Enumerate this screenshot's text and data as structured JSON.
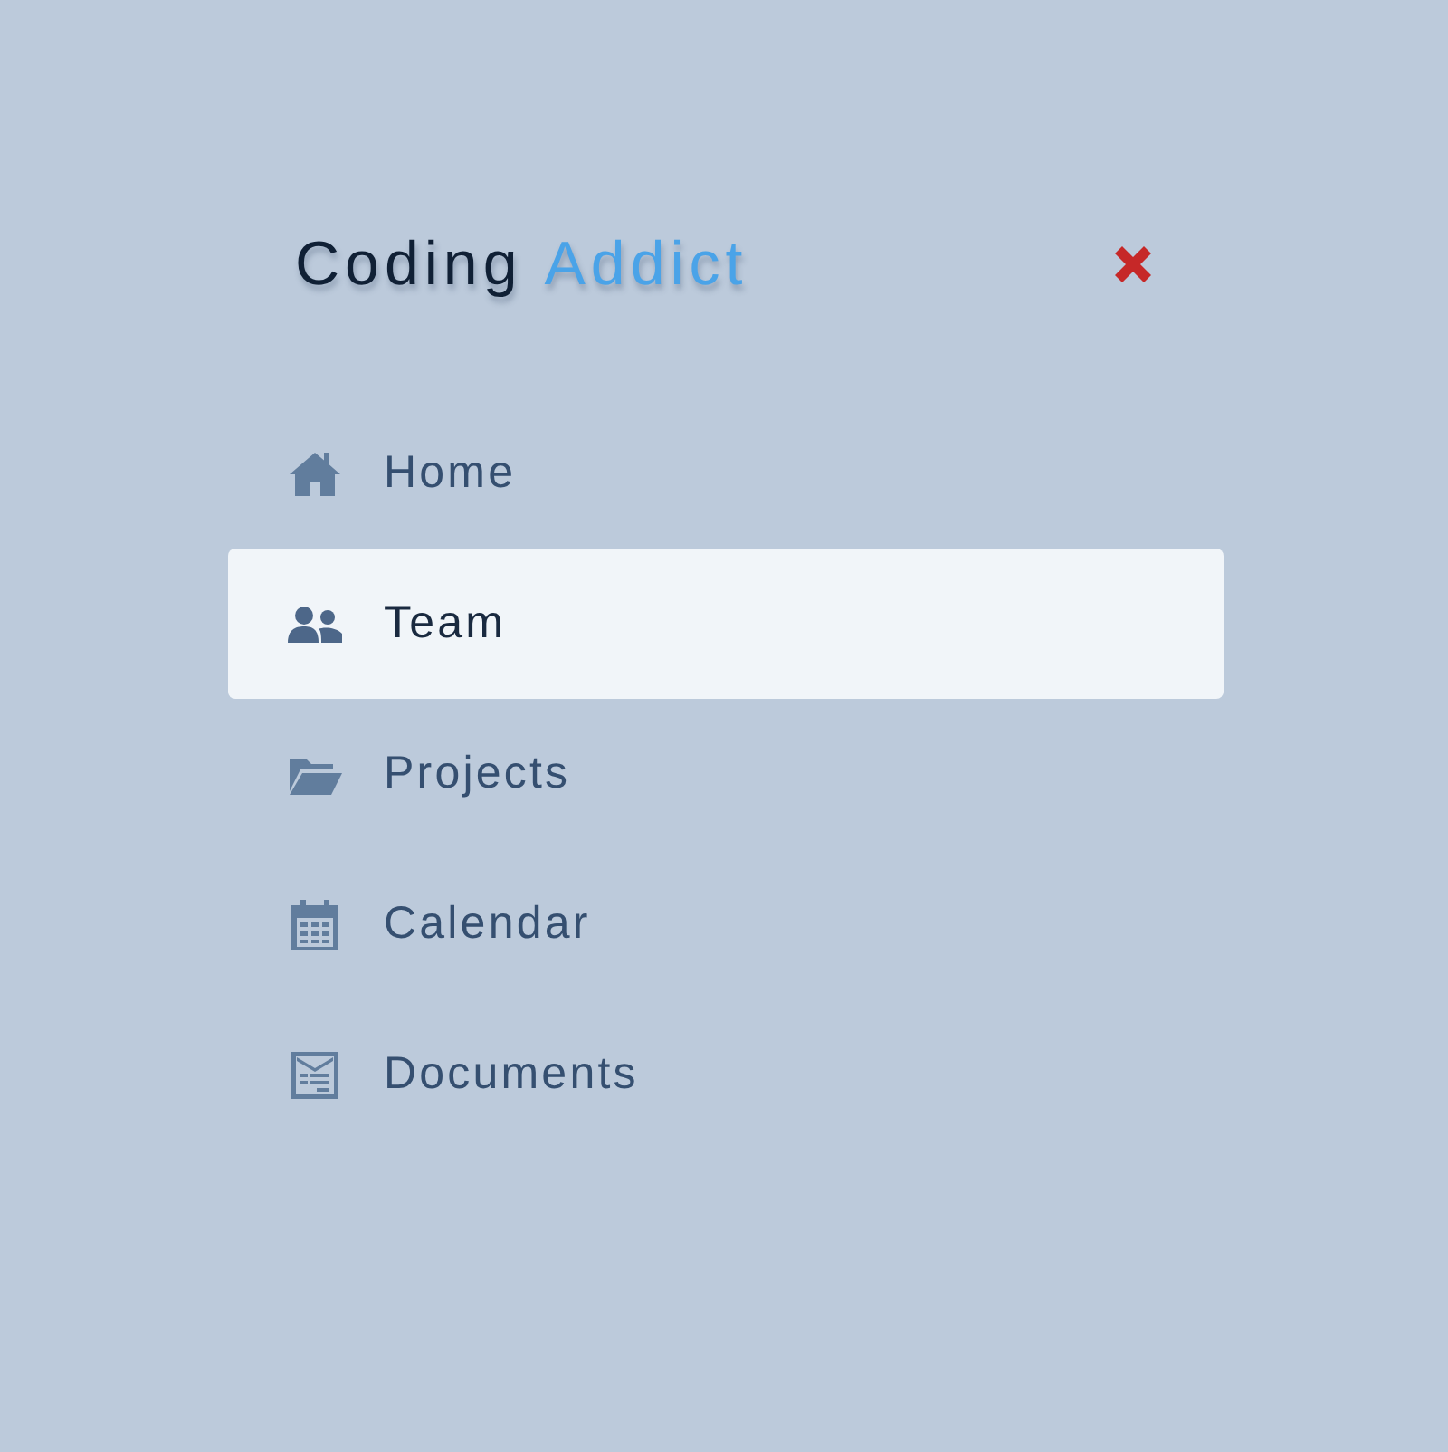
{
  "header": {
    "title_first": "Coding",
    "title_second": "Addict"
  },
  "nav": [
    {
      "label": "Home",
      "selected": false
    },
    {
      "label": "Team",
      "selected": true
    },
    {
      "label": "Projects",
      "selected": false
    },
    {
      "label": "Calendar",
      "selected": false
    },
    {
      "label": "Documents",
      "selected": false
    }
  ]
}
